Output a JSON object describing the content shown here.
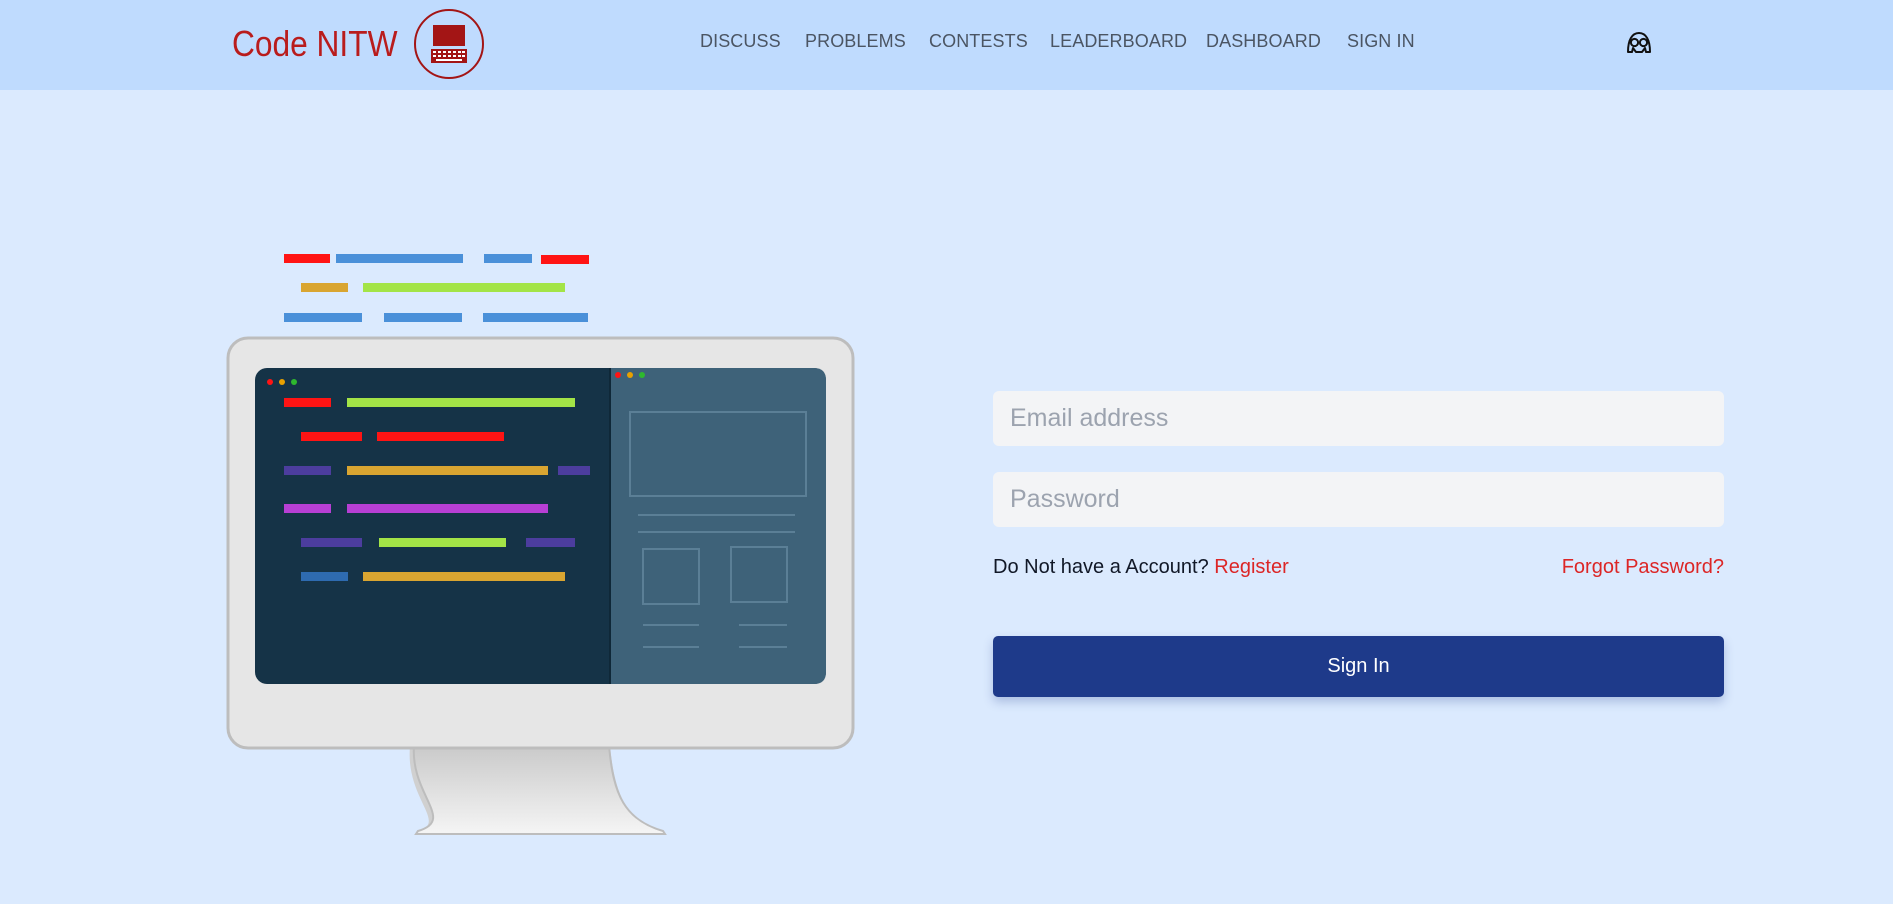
{
  "brand": {
    "name": "Code NITW",
    "logo_icon": "computer-keyboard-icon",
    "accent_color": "#b91c1c"
  },
  "nav": {
    "items": [
      {
        "label": "DISCUSS"
      },
      {
        "label": "PROBLEMS"
      },
      {
        "label": "CONTESTS"
      },
      {
        "label": "LEADERBOARD"
      },
      {
        "label": "DASHBOARD"
      },
      {
        "label": "SIGN IN"
      }
    ],
    "user_icon": "hacker-avatar-icon"
  },
  "illustration": {
    "name": "desktop-monitor-with-code",
    "colors": {
      "red": "#ff1414",
      "blue": "#4a90d9",
      "green": "#a3e447",
      "gold": "#d9a531",
      "purple": "#4c3d9e",
      "magenta": "#b73fd4",
      "editor_bg": "#153347",
      "preview_bg": "#3e6279",
      "monitor_frame": "#e6e6e6"
    }
  },
  "login": {
    "email_placeholder": "Email address",
    "email_value": "",
    "password_placeholder": "Password",
    "password_value": "",
    "no_account_text": "Do Not have a Account?",
    "register_label": "Register",
    "forgot_label": "Forgot Password?",
    "submit_label": "Sign In",
    "button_color": "#1e3a8a",
    "link_color": "#dc2626"
  }
}
